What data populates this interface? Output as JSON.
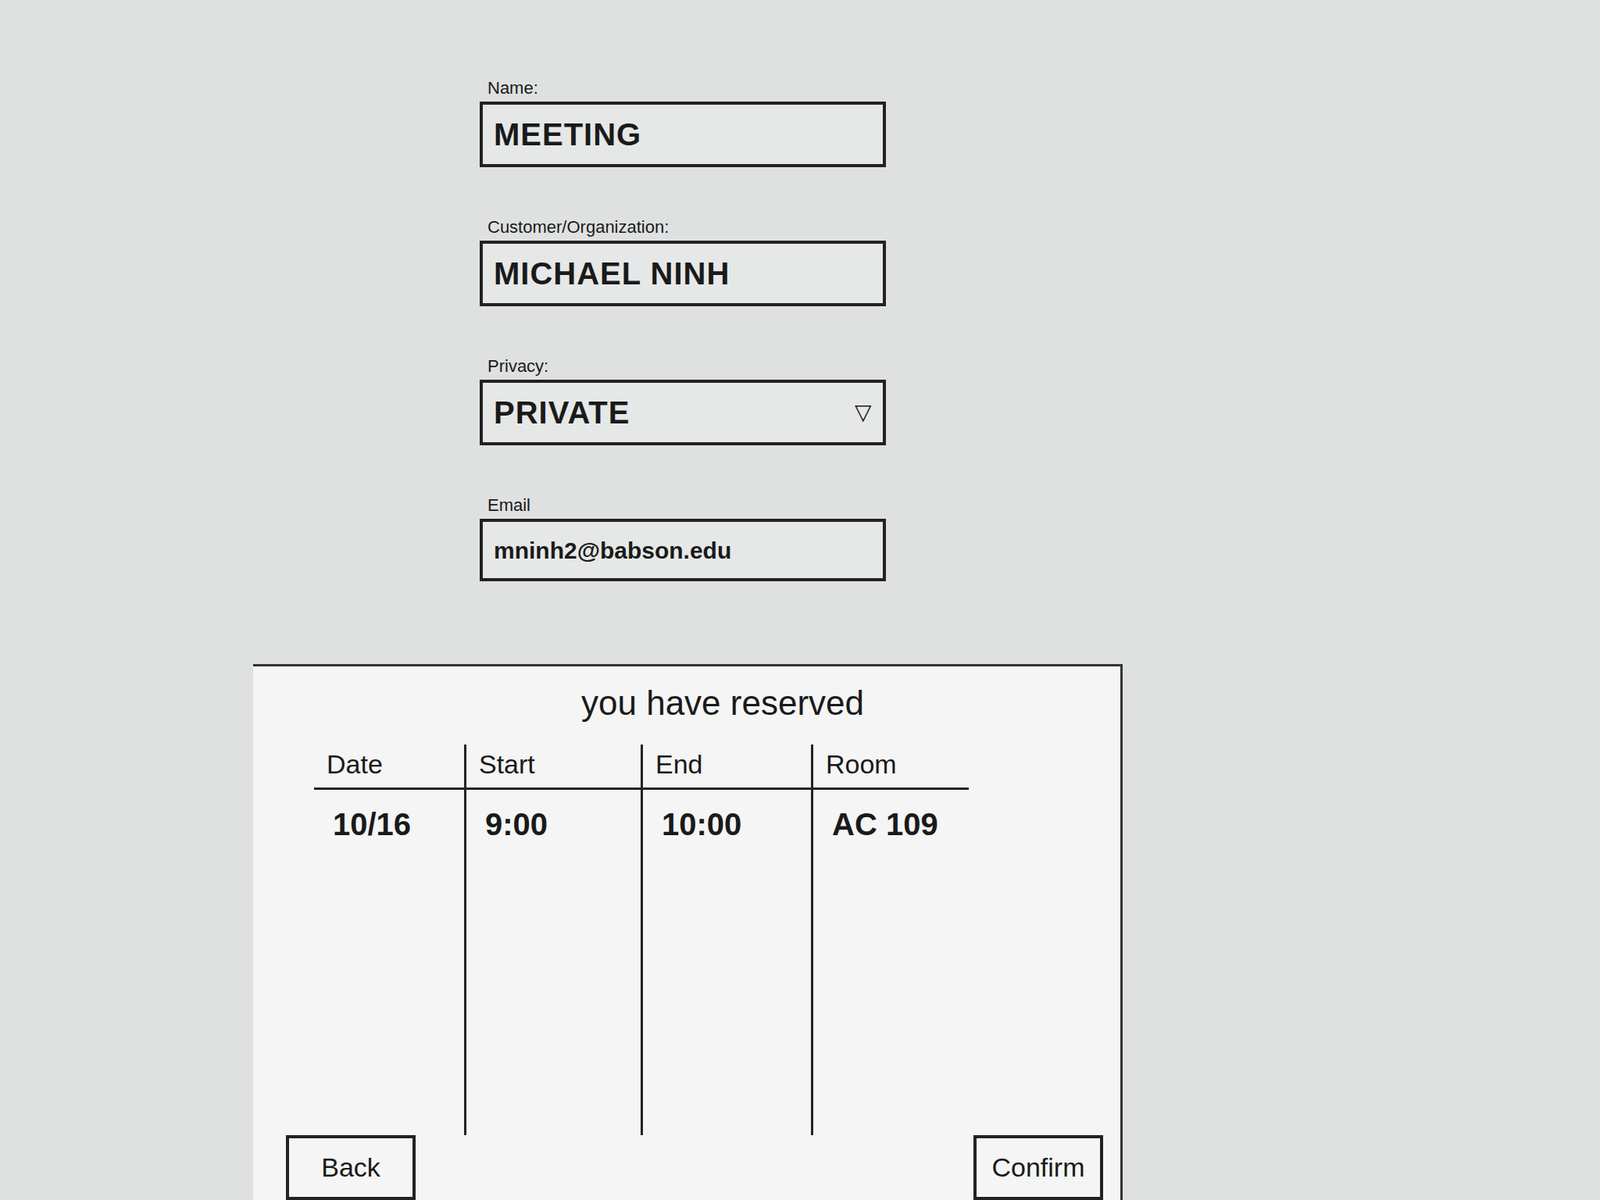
{
  "form": {
    "fields": [
      {
        "label": "Name:",
        "value": "MEETING",
        "kind": "text",
        "arrow": ""
      },
      {
        "label": "Customer/Organization:",
        "value": "MICHAEL NINH",
        "kind": "text",
        "arrow": ""
      },
      {
        "label": "Privacy:",
        "value": "PRIVATE",
        "kind": "select",
        "arrow": "▽"
      },
      {
        "label": "Email",
        "value": "mninh2@babson.edu",
        "kind": "text",
        "arrow": ""
      }
    ]
  },
  "reservation": {
    "title": "you have reserved",
    "columns": [
      "Date",
      "Start",
      "End",
      "Room"
    ],
    "rows": [
      [
        "10/16",
        "9:00",
        "10:00",
        "AC 109"
      ]
    ]
  },
  "buttons": [
    {
      "label": "Back",
      "side": "left"
    },
    {
      "label": "Confirm",
      "side": "right"
    }
  ]
}
